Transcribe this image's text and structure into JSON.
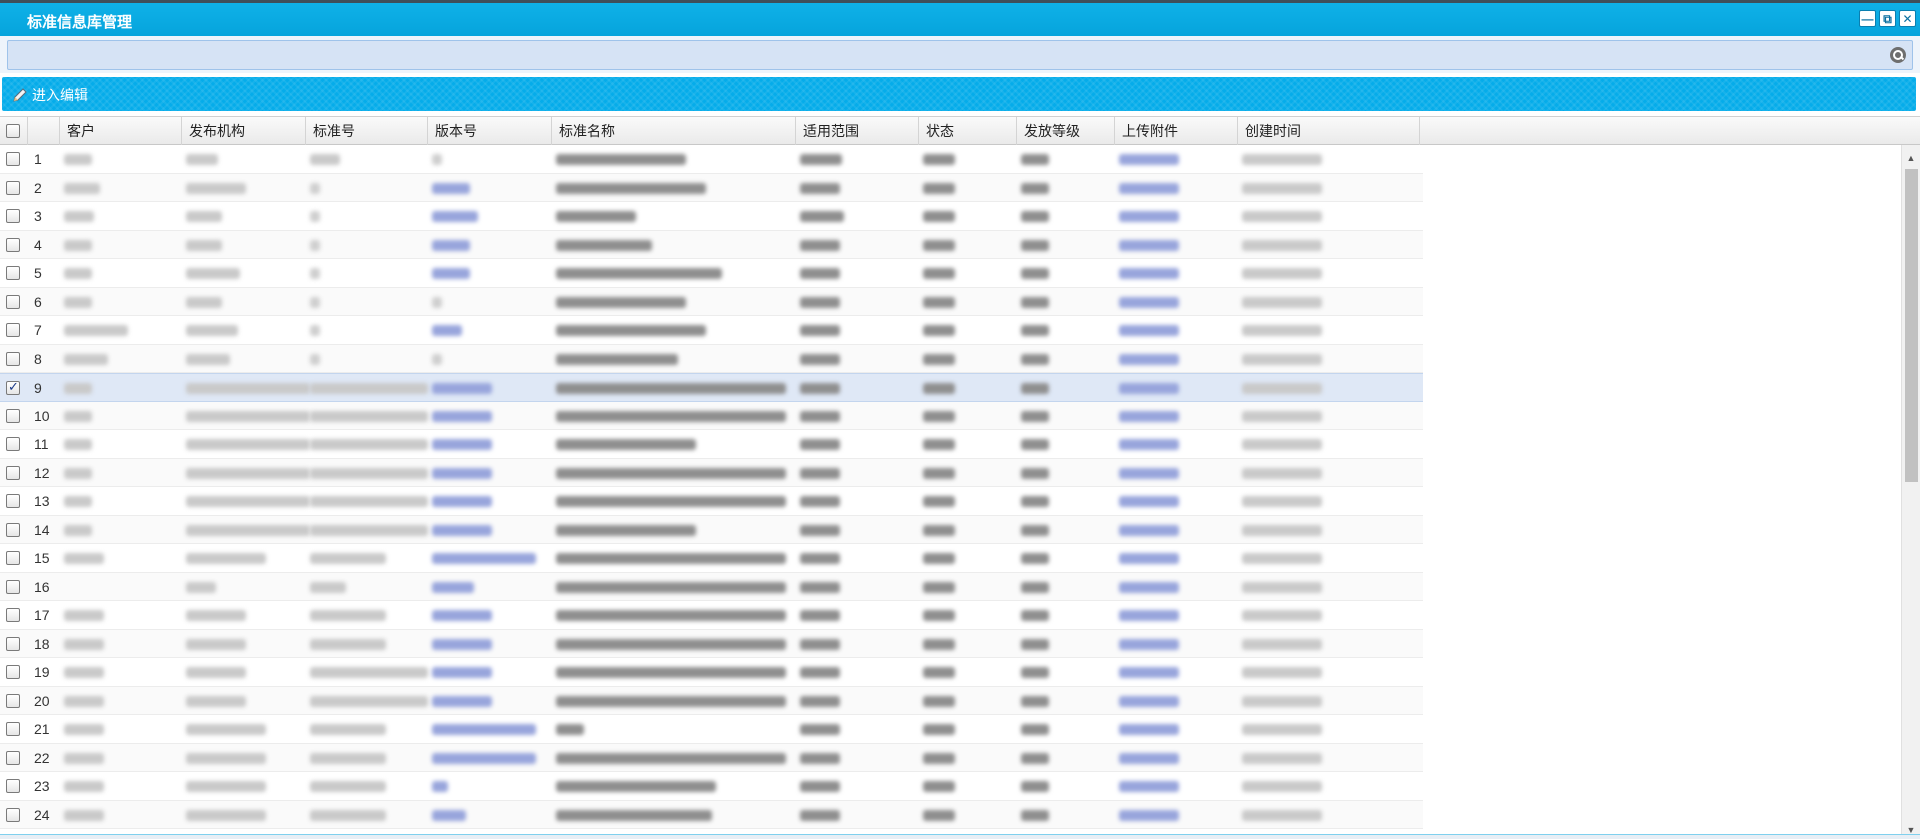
{
  "window": {
    "title": "标准信息库管理",
    "controls": [
      "minimize-icon",
      "restore-icon",
      "close-icon"
    ]
  },
  "search": {
    "placeholder": "",
    "value": ""
  },
  "toolbar": {
    "edit_label": "进入编辑",
    "edit_icon": "pencil-icon"
  },
  "grid": {
    "columns": [
      "客户",
      "发布机构",
      "标准号",
      "版本号",
      "标准名称",
      "适用范围",
      "状态",
      "发放等级",
      "上传附件",
      "创建时间"
    ],
    "rows": [
      {
        "num": "1",
        "checked": false
      },
      {
        "num": "2",
        "checked": false
      },
      {
        "num": "3",
        "checked": false
      },
      {
        "num": "4",
        "checked": false
      },
      {
        "num": "5",
        "checked": false
      },
      {
        "num": "6",
        "checked": false
      },
      {
        "num": "7",
        "checked": false
      },
      {
        "num": "8",
        "checked": false
      },
      {
        "num": "9",
        "checked": true
      },
      {
        "num": "10",
        "checked": false
      },
      {
        "num": "11",
        "checked": false
      },
      {
        "num": "12",
        "checked": false
      },
      {
        "num": "13",
        "checked": false
      },
      {
        "num": "14",
        "checked": false
      },
      {
        "num": "15",
        "checked": false
      },
      {
        "num": "16",
        "checked": false
      },
      {
        "num": "17",
        "checked": false
      },
      {
        "num": "18",
        "checked": false
      },
      {
        "num": "19",
        "checked": false
      },
      {
        "num": "20",
        "checked": false
      },
      {
        "num": "21",
        "checked": false
      },
      {
        "num": "22",
        "checked": false
      },
      {
        "num": "23",
        "checked": false
      },
      {
        "num": "24",
        "checked": false
      }
    ]
  },
  "colors": {
    "title_bar": "#06a4dc",
    "toolbar": "#05acea",
    "selected_row": "#dfe8f6",
    "link_blur": "#98a5dc"
  }
}
